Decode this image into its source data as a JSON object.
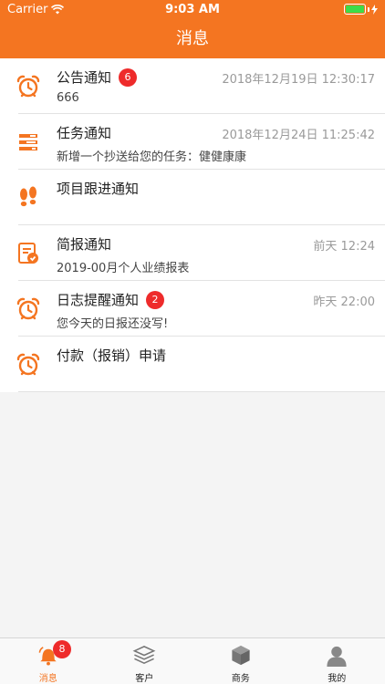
{
  "status_bar": {
    "carrier": "Carrier",
    "time": "9:03 AM"
  },
  "nav": {
    "title": "消息"
  },
  "messages": [
    {
      "title": "公告通知",
      "badge": "6",
      "time": "2018年12月19日 12:30:17",
      "subtitle": "666",
      "icon": "alarm-clock-icon"
    },
    {
      "title": "任务通知",
      "badge": "",
      "time": "2018年12月24日 11:25:42",
      "subtitle": "新增一个抄送给您的任务：健健康康",
      "icon": "task-list-icon"
    },
    {
      "title": "项目跟进通知",
      "badge": "",
      "time": "",
      "subtitle": "",
      "icon": "footprints-icon"
    },
    {
      "title": "简报通知",
      "badge": "",
      "time": "前天  12:24",
      "subtitle": "2019-00月个人业绩报表",
      "icon": "report-icon"
    },
    {
      "title": "日志提醒通知",
      "badge": "2",
      "time": "昨天  22:00",
      "subtitle": "您今天的日报还没写!",
      "icon": "alarm-clock-icon"
    },
    {
      "title": "付款（报销）申请",
      "badge": "",
      "time": "",
      "subtitle": "",
      "icon": "alarm-clock-icon"
    }
  ],
  "tabs": [
    {
      "label": "消息",
      "badge": "8",
      "icon": "bell-icon",
      "active": true
    },
    {
      "label": "客户",
      "badge": "",
      "icon": "layers-icon",
      "active": false
    },
    {
      "label": "商务",
      "badge": "",
      "icon": "cube-icon",
      "active": false
    },
    {
      "label": "我的",
      "badge": "",
      "icon": "user-icon",
      "active": false
    }
  ],
  "colors": {
    "accent": "#f47521",
    "badge": "#ee2b2b"
  }
}
